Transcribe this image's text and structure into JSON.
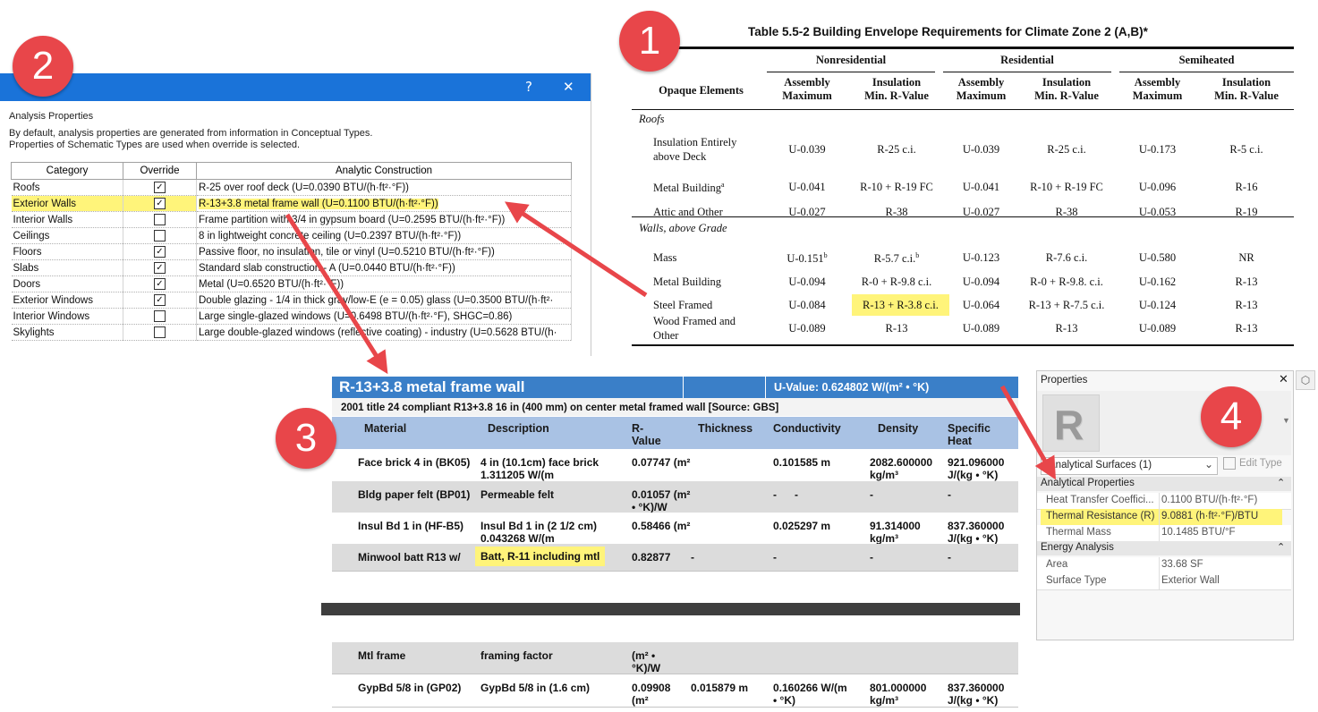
{
  "badges": [
    "1",
    "2",
    "3",
    "4"
  ],
  "dialog": {
    "help_glyph": "?",
    "close_glyph": "✕",
    "group_label": "Analysis Properties",
    "desc_line1": "By default, analysis properties are generated from information in Conceptual Types.",
    "desc_line2": "Properties of Schematic Types are used when override is selected.",
    "columns": [
      "Category",
      "Override",
      "Analytic Construction"
    ],
    "rows": [
      {
        "category": "Roofs",
        "override": true,
        "construction": "R-25 over roof deck (U=0.0390 BTU/(h·ft²·°F))"
      },
      {
        "category": "Exterior Walls",
        "override": true,
        "construction": "R-13+3.8 metal frame wall (U=0.1100 BTU/(h·ft²·°F))"
      },
      {
        "category": "Interior Walls",
        "override": false,
        "construction": "Frame partition with 3/4 in gypsum board (U=0.2595 BTU/(h·ft²·°F))"
      },
      {
        "category": "Ceilings",
        "override": false,
        "construction": "8 in lightweight concrete ceiling (U=0.2397 BTU/(h·ft²·°F))"
      },
      {
        "category": "Floors",
        "override": true,
        "construction": "Passive floor, no insulation, tile or vinyl (U=0.5210 BTU/(h·ft²·°F))"
      },
      {
        "category": "Slabs",
        "override": true,
        "construction": "Standard slab construction - A (U=0.0440 BTU/(h·ft²·°F))"
      },
      {
        "category": "Doors",
        "override": true,
        "construction": "Metal (U=0.6520 BTU/(h·ft²·°F))"
      },
      {
        "category": "Exterior Windows",
        "override": true,
        "construction": "Double glazing - 1/4 in thick gray/low-E (e = 0.05) glass (U=0.3500 BTU/(h·ft²·"
      },
      {
        "category": "Interior Windows",
        "override": false,
        "construction": "Large single-glazed windows (U=0.6498 BTU/(h·ft²·°F), SHGC=0.86)"
      },
      {
        "category": "Skylights",
        "override": false,
        "construction": "Large double-glazed windows (reflective coating) - industry (U=0.5628 BTU/(h·"
      }
    ]
  },
  "table1": {
    "title": "Table 5.5-2  Building Envelope Requirements for Climate Zone 2 (A,B)*",
    "groups": [
      "Nonresidential",
      "Residential",
      "Semiheated"
    ],
    "opaque_label": "Opaque Elements",
    "sub_a1": "Assembly",
    "sub_a2": "Maximum",
    "sub_i1": "Insulation",
    "sub_i2": "Min. R-Value",
    "sections": [
      {
        "name": "Roofs",
        "rows": [
          {
            "label": [
              "Insulation Entirely",
              "above Deck"
            ],
            "vals": [
              "U-0.039",
              "R-25 c.i.",
              "U-0.039",
              "R-25 c.i.",
              "U-0.173",
              "R-5 c.i."
            ]
          },
          {
            "label": [
              "Metal Building"
            ],
            "sup": "a",
            "vals": [
              "U-0.041",
              "R-10 + R-19 FC",
              "U-0.041",
              "R-10 + R-19 FC",
              "U-0.096",
              "R-16"
            ]
          },
          {
            "label": [
              "Attic and Other"
            ],
            "vals": [
              "U-0.027",
              "R-38",
              "U-0.027",
              "R-38",
              "U-0.053",
              "R-19"
            ]
          }
        ]
      },
      {
        "name": "Walls, above Grade",
        "rows": [
          {
            "label": [
              "Mass"
            ],
            "vals": [
              "U-0.151",
              "R-5.7 c.i.",
              "U-0.123",
              "R-7.6 c.i.",
              "U-0.580",
              "NR"
            ],
            "sups": [
              "b",
              "b"
            ]
          },
          {
            "label": [
              "Metal Building"
            ],
            "vals": [
              "U-0.094",
              "R-0 + R-9.8 c.i.",
              "U-0.094",
              "R-0 + R-9.8. c.i.",
              "U-0.162",
              "R-13"
            ]
          },
          {
            "label": [
              "Steel Framed"
            ],
            "vals": [
              "U-0.084",
              "R-13 + R-3.8 c.i.",
              "U-0.064",
              "R-13 + R-7.5 c.i.",
              "U-0.124",
              "R-13"
            ]
          },
          {
            "label": [
              "Wood Framed and",
              "Other"
            ],
            "vals": [
              "U-0.089",
              "R-13",
              "U-0.089",
              "R-13",
              "U-0.089",
              "R-13"
            ]
          }
        ]
      }
    ]
  },
  "panel3": {
    "title": "R-13+3.8 metal frame wall",
    "uvalue": "U-Value: 0.624802 W/(m² • °K)",
    "source": "2001 title 24 compliant R13+3.8 16 in (400 mm) on center metal framed wall [Source: GBS]",
    "columns": [
      "Material",
      "Description",
      "R-\nValue",
      "Thickness",
      "Conductivity",
      "Density",
      "Specific\nHeat"
    ],
    "rows": [
      {
        "material": "Face brick 4 in (BK05)",
        "description": "4 in (10.1cm) face brick\n1.311205 W/(m",
        "r_value": "0.07747 (m²",
        "thickness": "",
        "conductivity": "0.101585 m",
        "density": "2082.600000\nkg/m³",
        "specific_heat": "921.096000\nJ/(kg • °K)"
      },
      {
        "material": "Bldg paper felt (BP01)",
        "description": "Permeable felt",
        "r_value": "0.01057 (m²\n• °K)/W",
        "thickness": "",
        "conductivity": "-      -",
        "density": "-",
        "specific_heat": "-"
      },
      {
        "material": "Insul Bd 1 in (HF-B5)",
        "description": "Insul Bd 1 in (2 1/2 cm)\n0.043268 W/(m",
        "r_value": "0.58466 (m²",
        "thickness": "",
        "conductivity": "0.025297 m",
        "density": "91.314000\nkg/m³",
        "specific_heat": "837.360000\nJ/(kg • °K)"
      },
      {
        "material": "Minwool batt R13 w/",
        "description": "Batt, R-11 including mtl",
        "r_value": "0.82877",
        "thickness": "-",
        "conductivity": "-",
        "density": "-",
        "specific_heat": "-"
      }
    ],
    "rows_lower": [
      {
        "material": "Mtl frame",
        "description": "framing factor",
        "r_value": "(m² •\n°K)/W",
        "thickness": "",
        "conductivity": "",
        "density": "",
        "specific_heat": ""
      },
      {
        "material": "GypBd 5/8 in (GP02)",
        "description": "GypBd 5/8 in (1.6 cm)",
        "r_value": "0.09908\n(m²",
        "thickness": "0.015879 m",
        "conductivity": "0.160266 W/(m\n• °K)",
        "density": "801.000000\nkg/m³",
        "specific_heat": "837.360000\nJ/(kg • °K)"
      }
    ]
  },
  "properties": {
    "title": "Properties",
    "logo_letter": "R",
    "type_selector": "Analytical Surfaces (1)",
    "edit_type": "Edit Type",
    "sections": [
      {
        "name": "Analytical Properties",
        "rows": [
          {
            "key": "Heat Transfer Coeffici...",
            "value": "0.1100 BTU/(h·ft²·°F)"
          },
          {
            "key": "Thermal Resistance (R)",
            "value": "9.0881 (h·ft²·°F)/BTU",
            "highlight": true
          },
          {
            "key": "Thermal Mass",
            "value": "10.1485 BTU/°F"
          }
        ]
      },
      {
        "name": "Energy Analysis",
        "rows": [
          {
            "key": "Area",
            "value": "33.68 SF"
          },
          {
            "key": "Surface Type",
            "value": "Exterior Wall"
          }
        ]
      }
    ],
    "collapse_glyph": "⌃"
  },
  "colors": {
    "badge": "#e8464a",
    "arrow": "#e8464a",
    "highlight": "#fff47a",
    "titlebar": "#1a73d9",
    "panel_header": "#3a7fc8",
    "panel_colhead": "#a9c2e4"
  }
}
